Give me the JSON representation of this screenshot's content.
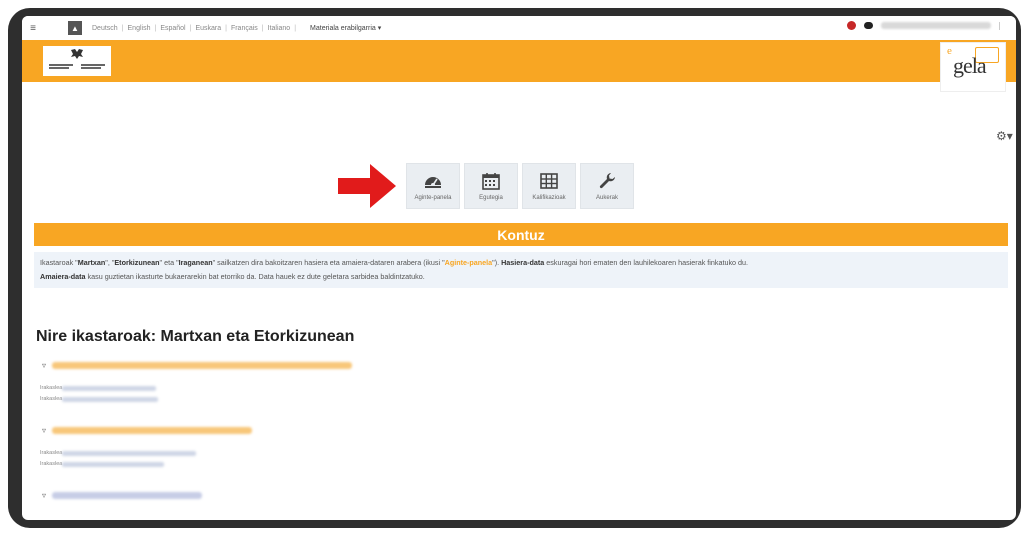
{
  "topbar": {
    "languages": [
      "Deutsch",
      "English",
      "Español",
      "Euskara",
      "Français",
      "Italiano"
    ],
    "materials_menu": "Materiala erabilgarria ▾"
  },
  "header": {
    "egela_logo": {
      "prefix": "e",
      "main": "gela"
    },
    "accent_color": "#f8a623"
  },
  "nav_icons": [
    {
      "label": "Aginte-panela",
      "icon": "dashboard-icon"
    },
    {
      "label": "Egutegia",
      "icon": "calendar-icon"
    },
    {
      "label": "Kalifikazioak",
      "icon": "grades-table-icon"
    },
    {
      "label": "Aukerak",
      "icon": "wrench-icon"
    }
  ],
  "kontuz": {
    "title": "Kontuz",
    "p1": "Ikastaroak \"",
    "b1": "Martxan",
    "p2": "\", \"",
    "b2": "Etorkizunean",
    "p3": "\" eta \"",
    "b3": "Iraganean",
    "p4": "\" sailkatzen dira bakoitzaren hasiera eta amaiera-dataren arabera (ikusi \"",
    "link": "Aginte-panela",
    "p5": "\"). ",
    "b4": "Hasiera-data",
    "p6": " eskuragai hori ematen den lauhilekoaren hasierak finkatuko du.",
    "b5": "Amaiera-data",
    "p7": " kasu guztietan ikasturte bukaerarekin bat etorriko da. Data hauek ez dute geletara sarbidea baldintzatuko."
  },
  "section_title": "Nire ikastaroak: Martxan eta Etorkizunean",
  "courses": [
    {
      "teacher_label_1": "Irakaslea",
      "teacher_label_2": "Irakaslea"
    },
    {
      "teacher_label_1": "Irakaslea",
      "teacher_label_2": "Irakaslea"
    },
    {}
  ]
}
